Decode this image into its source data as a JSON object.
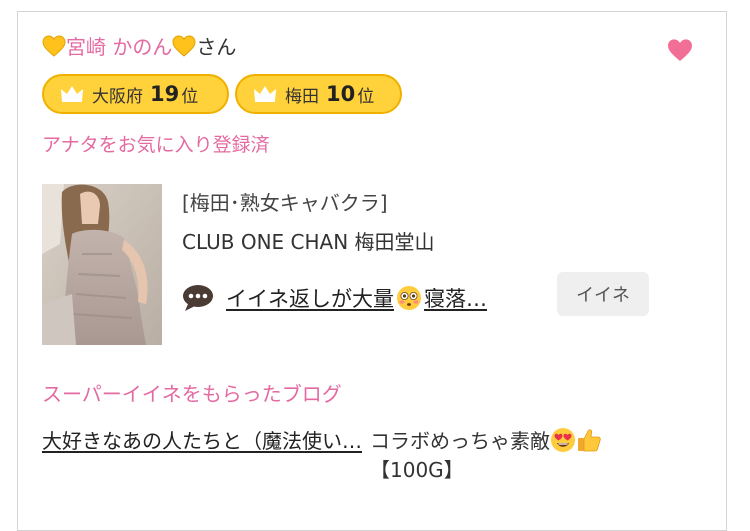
{
  "cast": {
    "name": "宮崎 かのん",
    "honorific": "さん",
    "heart_emoji_icon": "yellow-heart",
    "favorite_icon": "heart-icon",
    "colors": {
      "name": "#e46aa2",
      "favorite_heart": "#f16f97",
      "badge_fill": "#ffd13a",
      "badge_border": "#efb100"
    }
  },
  "rankings": [
    {
      "area": "大阪府",
      "rank": "19",
      "unit": "位",
      "icon": "crown-icon"
    },
    {
      "area": "梅田",
      "rank": "10",
      "unit": "位",
      "icon": "crown-icon"
    }
  ],
  "favorite_status": "アナタをお気に入り登録済",
  "shop": {
    "category": "[梅田･熟女キャバクラ]",
    "name": "CLUB ONE CHAN 梅田堂山"
  },
  "message": {
    "icon": "speech-bubble-icon",
    "text_before": "イイネ返しが大量",
    "emoji": "flushed-face",
    "text_after": "寝落…",
    "iine_label": "イイネ"
  },
  "super_iine": {
    "title": "スーパーイイネをもらったブログ",
    "blog_title": "大好きなあの人たちと（魔法使い…",
    "comment_text": "コラボめっちゃ素敵",
    "comment_emojis": [
      "heart-eyes-face",
      "thumbs-up"
    ],
    "amount": "【100G】"
  }
}
